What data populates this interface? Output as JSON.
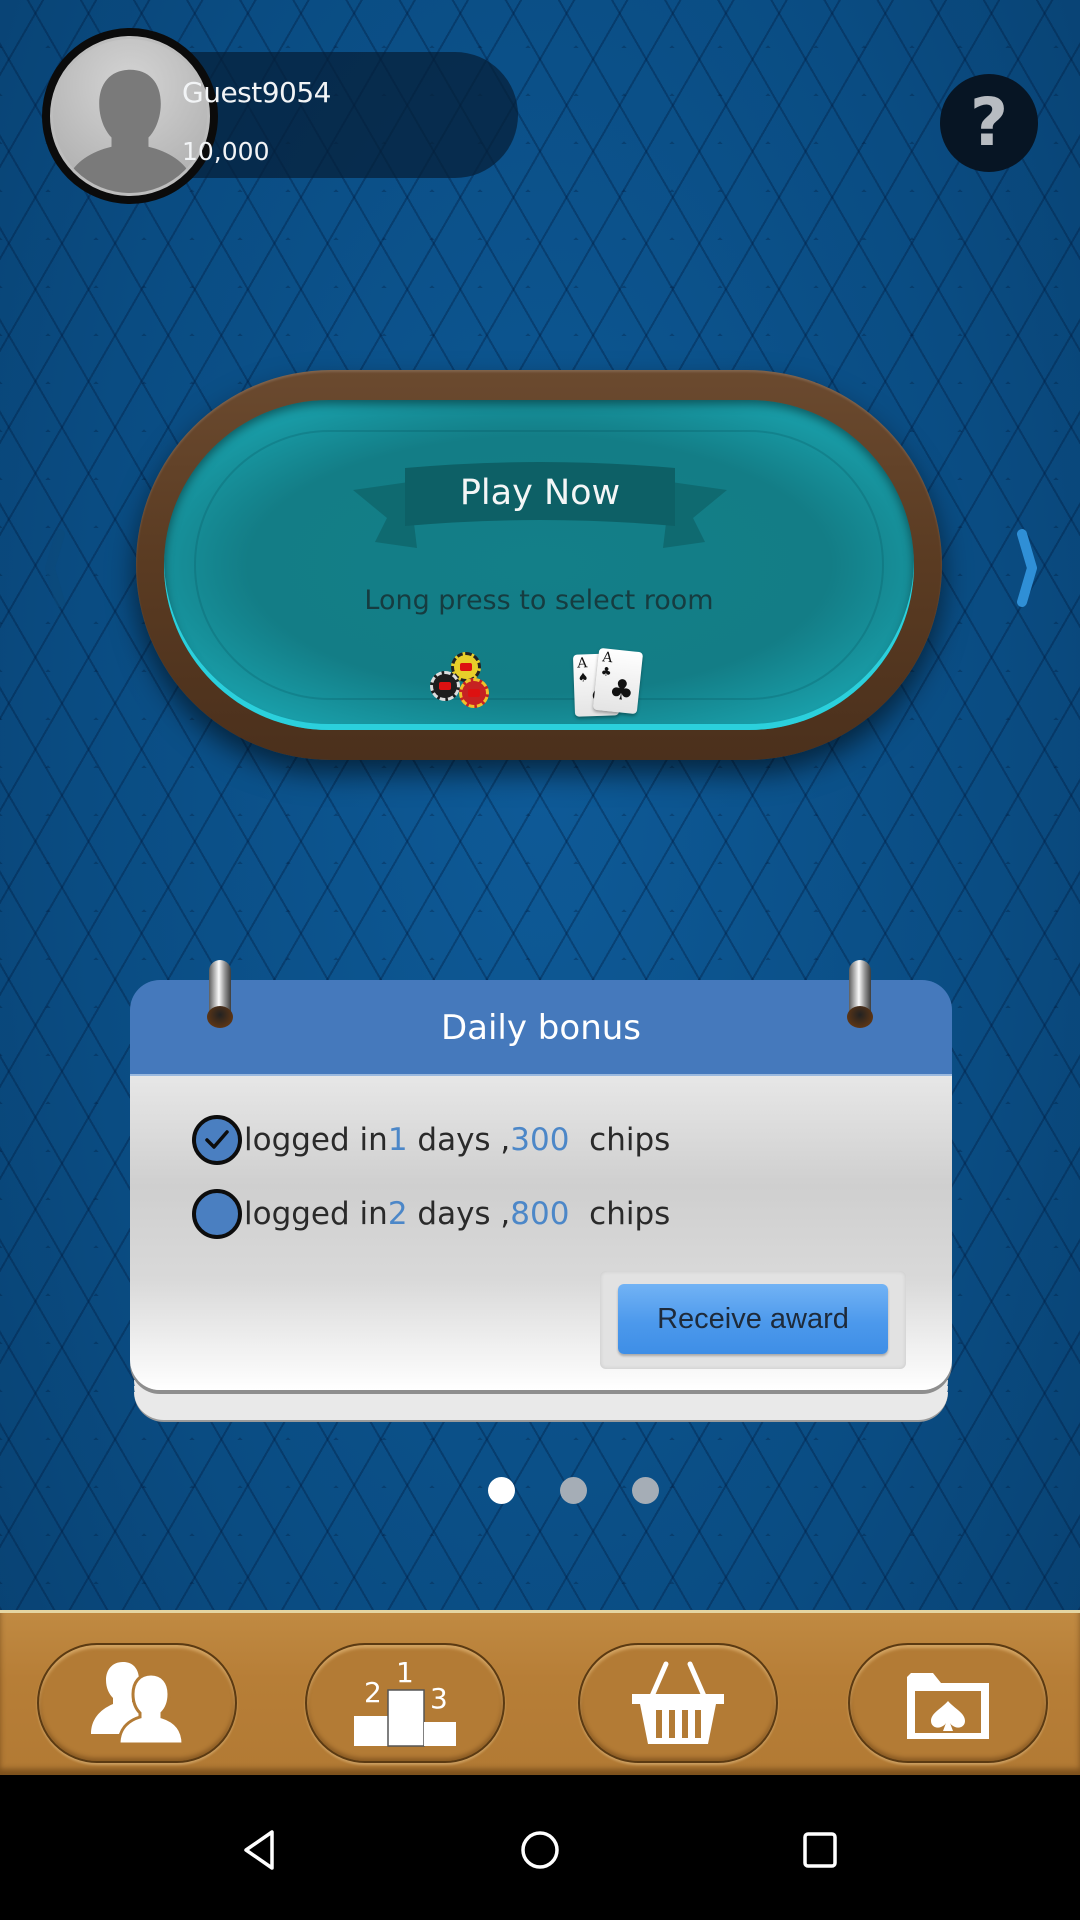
{
  "profile": {
    "username": "Guest9054",
    "chips": "10,000",
    "avatar_icon": "default-user-silhouette"
  },
  "header": {
    "help_icon": "question-mark-icon",
    "help_glyph": "?"
  },
  "play_table": {
    "title": "Play Now",
    "subtitle": "Long press to select room",
    "decor_icons": [
      "poker-chips-icon",
      "ace-cards-icon"
    ],
    "cards": [
      {
        "rank": "A",
        "suit": "♠"
      },
      {
        "rank": "A",
        "suit": "♣"
      }
    ],
    "carousel": {
      "prev_icon": "chevron-left-icon",
      "next_icon": "chevron-right-icon"
    }
  },
  "daily_bonus": {
    "title": "Daily bonus",
    "rows": [
      {
        "prefix": "logged in",
        "days": "1",
        "middle": " days ,",
        "chips": "300",
        "suffix": "  chips",
        "claimed": true
      },
      {
        "prefix": "logged in",
        "days": "2",
        "middle": " days ,",
        "chips": "800",
        "suffix": "  chips",
        "claimed": false
      }
    ],
    "receive_button": "Receive award"
  },
  "pager": {
    "pages": 3,
    "active_index": 0
  },
  "bottom_bar": {
    "buttons": [
      {
        "name": "friends",
        "icon": "two-people-icon"
      },
      {
        "name": "leaderboard",
        "icon": "podium-icon",
        "podium_labels": [
          "2",
          "1",
          "3"
        ]
      },
      {
        "name": "shop",
        "icon": "shopping-basket-icon"
      },
      {
        "name": "game-folder",
        "icon": "spade-folder-icon"
      }
    ]
  },
  "system_nav": {
    "buttons": [
      "back",
      "home",
      "recent-apps"
    ]
  },
  "colors": {
    "background": "#0a4f86",
    "felt": "#137f88",
    "rim": "#5a3b22",
    "bonus_header": "#4579bc",
    "highlight_text": "#4c87c8",
    "award_button": "#4c99ec",
    "bottom_bar": "#b77e37"
  }
}
